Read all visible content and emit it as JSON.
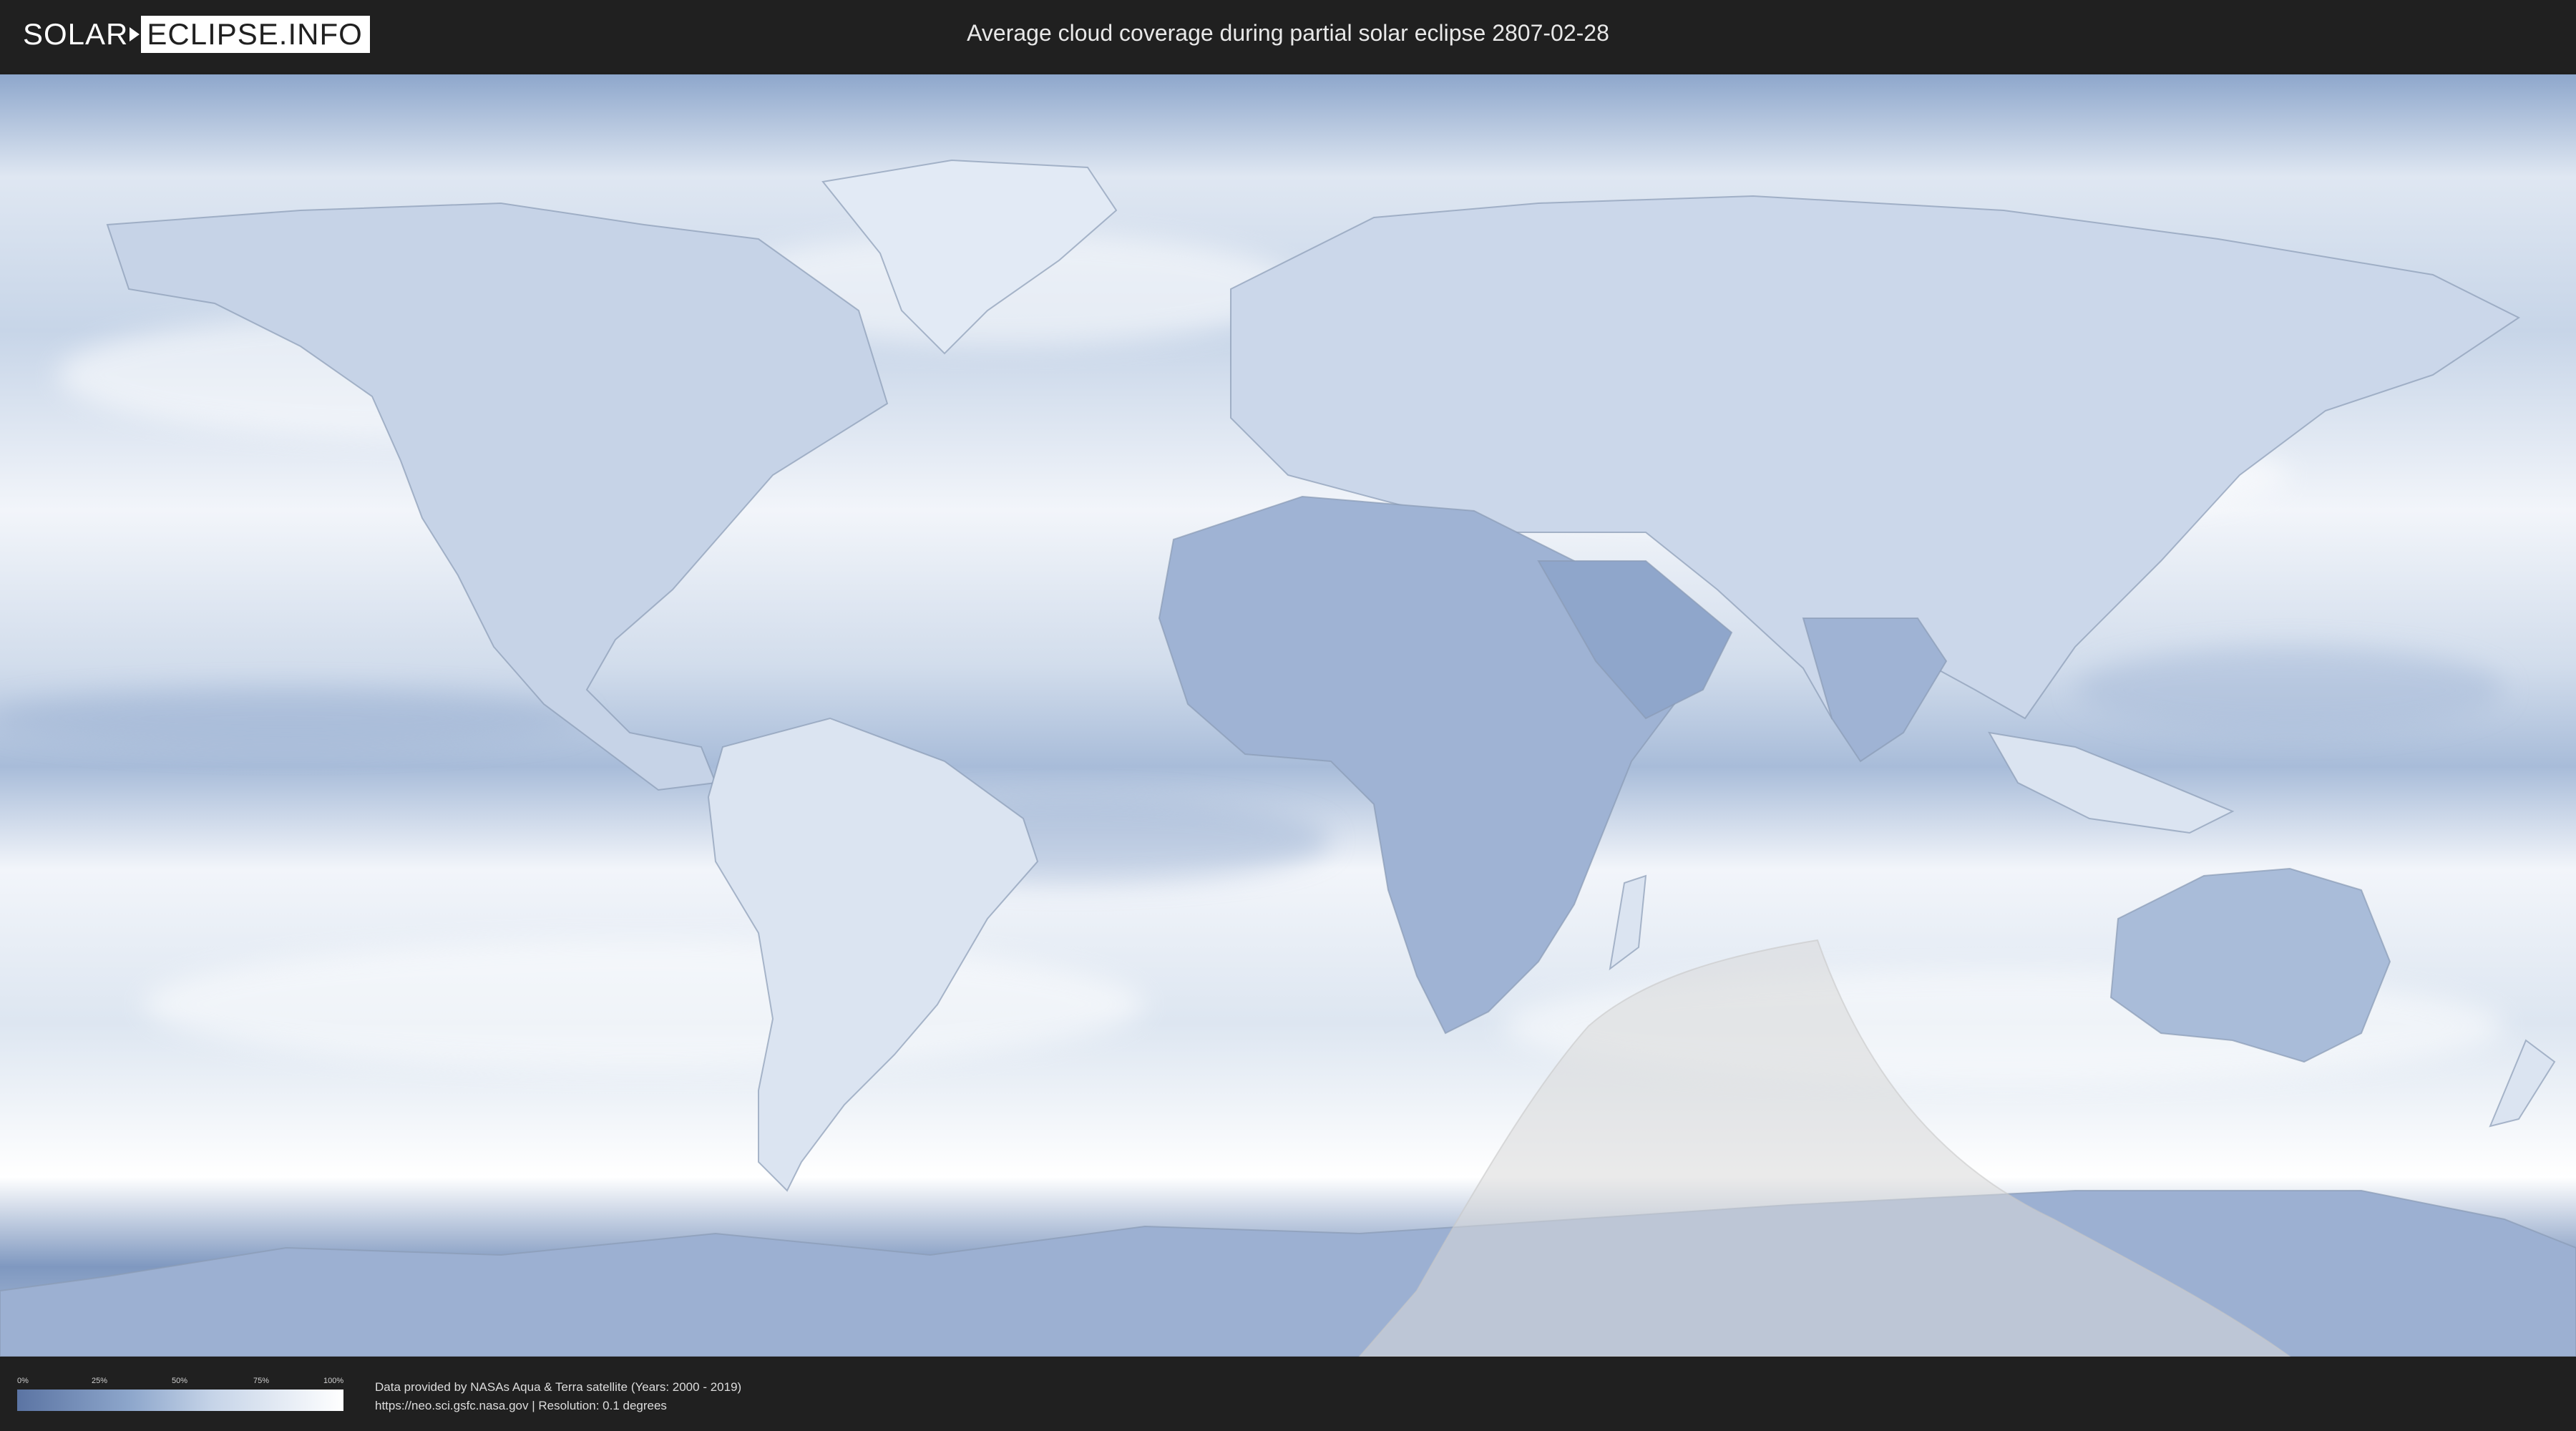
{
  "header": {
    "logo_left": "SOLAR",
    "logo_right": "ECLIPSE.INFO",
    "title": "Average cloud coverage during partial solar eclipse 2807-02-28"
  },
  "map": {
    "colors": {
      "ocean_clear": "#ffffff",
      "cloud_low": "#5b74a3",
      "cloud_mid": "#8ea7cc",
      "cloud_high": "#e8eef7",
      "eclipse_overlay": "#d8d8d8"
    }
  },
  "legend": {
    "ticks": [
      "0%",
      "25%",
      "50%",
      "75%",
      "100%"
    ]
  },
  "footer": {
    "credit_line1": "Data provided by NASAs Aqua & Terra satellite (Years: 2000 - 2019)",
    "credit_line2": "https://neo.sci.gsfc.nasa.gov | Resolution: 0.1 degrees"
  }
}
